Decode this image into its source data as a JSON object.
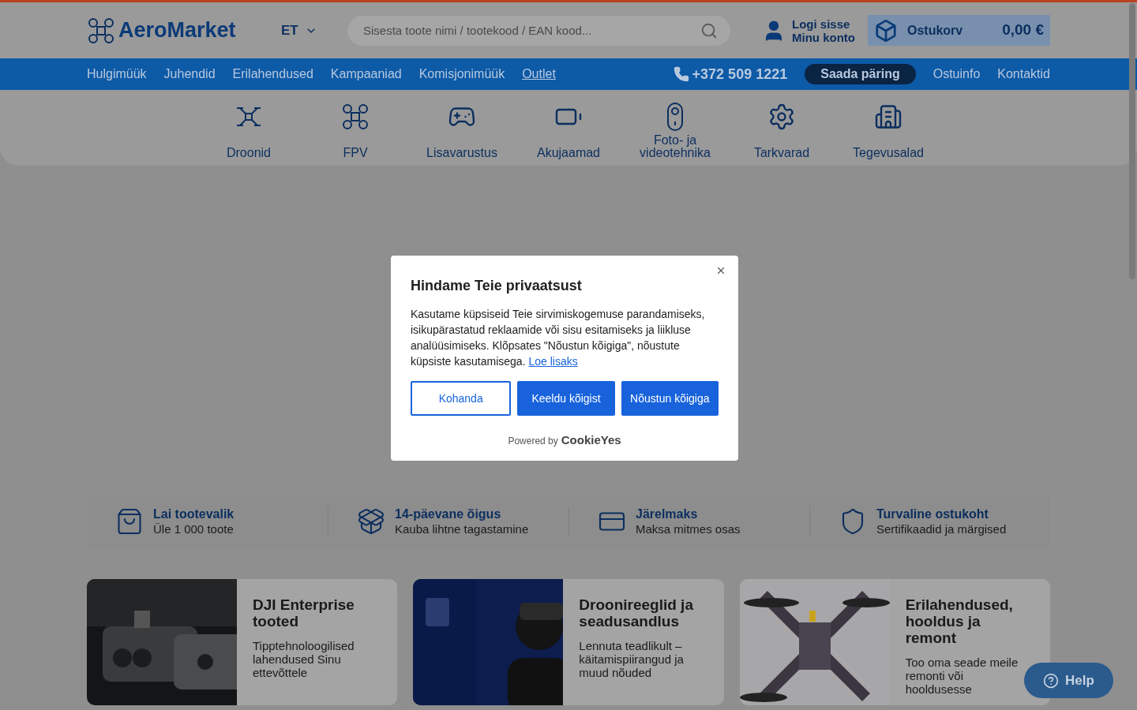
{
  "header": {
    "logo": "AeroMarket",
    "language": "ET",
    "search": {
      "placeholder": "Sisesta toote nimi / tootekood / EAN kood..."
    },
    "account": {
      "line_1": "Logi sisse",
      "line_2": "Minu konto"
    },
    "cart": {
      "label": "Ostukorv",
      "total": "0,00 €"
    }
  },
  "nav": {
    "links": [
      {
        "label": "Hulgimüük",
        "underlined": false
      },
      {
        "label": "Juhendid",
        "underlined": false
      },
      {
        "label": "Erilahendused",
        "underlined": false
      },
      {
        "label": "Kampaaniad",
        "underlined": false
      },
      {
        "label": "Komisjonimüük",
        "underlined": false
      },
      {
        "label": "Outlet",
        "underlined": true
      }
    ],
    "phone": "+372 509 1221",
    "request_button": "Saada päring",
    "right_links": [
      "Ostuinfo",
      "Kontaktid"
    ]
  },
  "categories": [
    {
      "label": "Droonid"
    },
    {
      "label": "FPV"
    },
    {
      "label": "Lisavarustus"
    },
    {
      "label": "Akujaamad"
    },
    {
      "label": "Foto- ja videotehnika"
    },
    {
      "label": "Tarkvarad"
    },
    {
      "label": "Tegevusalad"
    }
  ],
  "features": [
    {
      "title": "Lai tootevalik",
      "subtitle": "Üle 1 000 toote"
    },
    {
      "title": "14-päevane õigus",
      "subtitle": "Kauba lihtne tagastamine"
    },
    {
      "title": "Järelmaks",
      "subtitle": "Maksa mitmes osas"
    },
    {
      "title": "Turvaline ostukoht",
      "subtitle": "Sertifikaadid ja märgised"
    }
  ],
  "cards": [
    {
      "title": "DJI Enterprise tooted",
      "text": "Tipptehnoloogilised lahendused Sinu ettevõttele"
    },
    {
      "title": "Droonireeglid ja seadusandlus",
      "text": "Lennuta teadlikult – käitamispiirangud ja muud nõuded"
    },
    {
      "title": "Erilahendused, hooldus ja remont",
      "text": "Too oma seade meile remonti või hooldusesse"
    }
  ],
  "cookie_dialog": {
    "title": "Hindame Teie privaatsust",
    "body": "Kasutame küpsiseid Teie sirvimiskogemuse parandamiseks, isikupärastatud reklaamide või sisu esitamiseks ja liikluse analüüsimiseks. Klõpsates \"Nõustun kõigiga\", nõustute küpsiste kasutamisega.",
    "link": "Loe lisaks",
    "buttons": [
      {
        "label": "Kohanda",
        "kind": "outline"
      },
      {
        "label": "Keeldu kõigist",
        "kind": "solid"
      },
      {
        "label": "Nõustun kõigiga",
        "kind": "solid"
      }
    ],
    "powered_by": "Powered by",
    "brand": "CookieYes"
  },
  "help_button": "Help"
}
